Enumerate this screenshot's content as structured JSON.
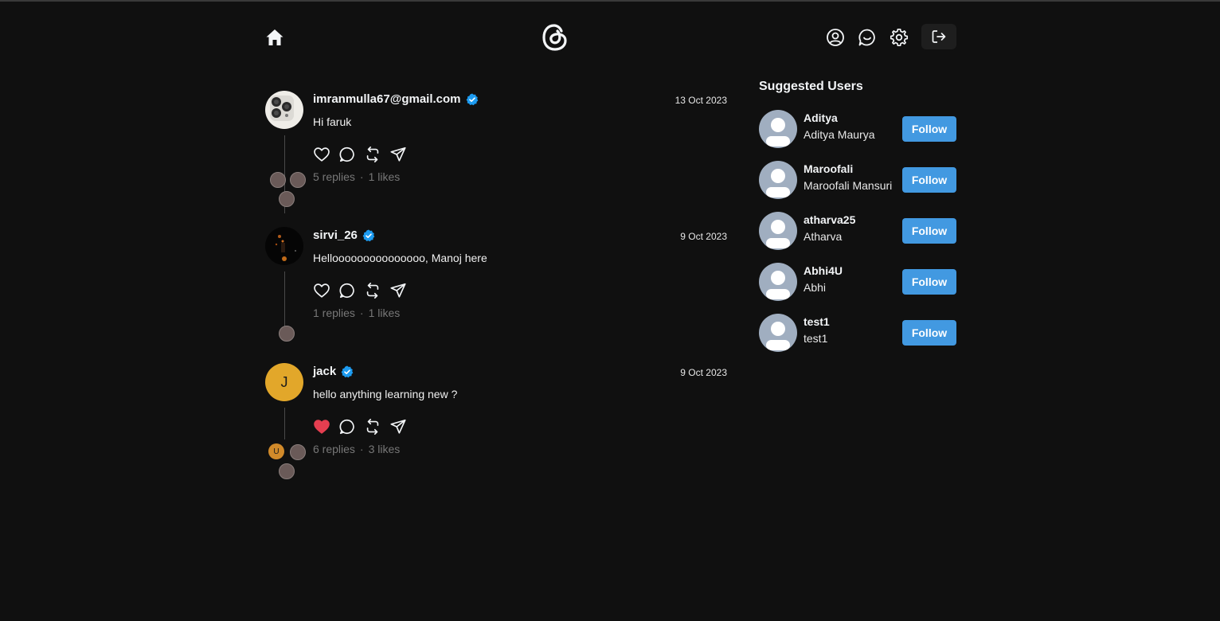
{
  "colors": {
    "background": "#101010",
    "accent": "#4299e1",
    "verified": "#1d9bf0",
    "liked": "#e53e50",
    "muted": "#777777"
  },
  "header": {
    "icons": [
      "home-icon",
      "threads-logo",
      "profile-icon",
      "chat-icon",
      "settings-icon",
      "logout-icon"
    ]
  },
  "posts": [
    {
      "username": "imranmulla67@gmail.com",
      "date": "13 Oct 2023",
      "text": "Hi faruk",
      "replies": "5 replies",
      "likes": "1 likes",
      "liked": false,
      "separator": "·"
    },
    {
      "username": "sirvi_26",
      "date": "9 Oct 2023",
      "text": "Hellooooooooooooooo, Manoj here",
      "replies": "1 replies",
      "likes": "1 likes",
      "liked": false,
      "separator": "·"
    },
    {
      "username": "jack",
      "avatar_letter": "J",
      "reply_letter": "U",
      "date": "9 Oct 2023",
      "text": "hello anything learning new ?",
      "replies": "6 replies",
      "likes": "3 likes",
      "liked": true,
      "separator": "·"
    }
  ],
  "suggested": {
    "title": "Suggested Users",
    "follow_label": "Follow",
    "users": [
      {
        "username": "Aditya",
        "name": "Aditya Maurya"
      },
      {
        "username": "Maroofali",
        "name": "Maroofali Mansuri"
      },
      {
        "username": "atharva25",
        "name": "Atharva"
      },
      {
        "username": "Abhi4U",
        "name": "Abhi"
      },
      {
        "username": "test1",
        "name": "test1"
      }
    ]
  }
}
